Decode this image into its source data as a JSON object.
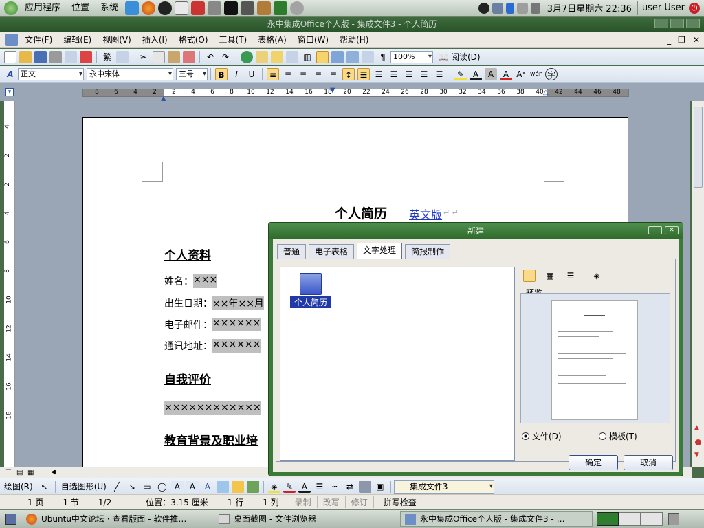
{
  "topbar": {
    "menus": [
      "应用程序",
      "位置",
      "系统"
    ],
    "clock": "3月7日星期六 22:36",
    "user": "user User"
  },
  "window": {
    "title": "永中集成Office个人版 - 集成文件3 - 个人简历"
  },
  "menubar": {
    "items": [
      "文件(F)",
      "编辑(E)",
      "视图(V)",
      "插入(I)",
      "格式(O)",
      "工具(T)",
      "表格(A)",
      "窗口(W)",
      "帮助(H)"
    ]
  },
  "toolbar": {
    "zoom": "100%",
    "read_label": "阅读(D)",
    "style": "正文",
    "font": "永中宋体",
    "size": "三号",
    "bold": "B",
    "italic": "I",
    "underline": "U"
  },
  "ruler": {
    "ticks": [
      "8",
      "6",
      "4",
      "2",
      "2",
      "4",
      "6",
      "8",
      "10",
      "12",
      "14",
      "16",
      "18",
      "20",
      "22",
      "24",
      "26",
      "28",
      "30",
      "32",
      "34",
      "36",
      "38",
      "40",
      "42",
      "44",
      "46",
      "48"
    ]
  },
  "vruler": {
    "ticks": [
      "4",
      "2",
      "2",
      "4",
      "6",
      "8",
      "10",
      "12",
      "14",
      "16",
      "18"
    ]
  },
  "document": {
    "title": "个人简历",
    "english_link": "英文版",
    "sections": [
      {
        "heading": "个人资料"
      },
      {
        "heading": "自我评价"
      },
      {
        "heading": "教育背景及职业培"
      }
    ],
    "fields": [
      {
        "label": "姓名：",
        "value": "×××"
      },
      {
        "label": "出生日期：",
        "value": "××年××月"
      },
      {
        "label": "电子邮件：",
        "value": "××××××"
      },
      {
        "label": "通讯地址：",
        "value": "××××××"
      }
    ],
    "self_eval_placeholder": "××××××××××××"
  },
  "drawbar": {
    "draw_label": "绘图(R)",
    "autoshape_label": "自选图形(U)",
    "file_combo": "集成文件3"
  },
  "status": {
    "page": "1 页",
    "section": "1 节",
    "pages": "1/2",
    "position": "位置：3.15 厘米",
    "line": "1 行",
    "col": "1 列",
    "record": "录制",
    "modify": "改写",
    "revise": "修订",
    "spell": "拼写检查"
  },
  "taskbar": {
    "items": [
      "Ubuntu中文论坛 · 查看版面 - 软件推…",
      "桌面截图 - 文件浏览器",
      "永中集成Office个人版 - 集成文件3 - …"
    ]
  },
  "dialog": {
    "title": "新建",
    "tabs": [
      "普通",
      "电子表格",
      "文字处理",
      "简报制作"
    ],
    "active_tab": "文字处理",
    "template_name": "个人简历",
    "preview_label": "预览",
    "create_as": [
      {
        "label": "文件(D)",
        "checked": true
      },
      {
        "label": "模板(T)",
        "checked": false
      }
    ],
    "ok": "确定",
    "cancel": "取消"
  },
  "colors": {
    "accent": "#3b7a38",
    "selection": "#1f3aa8",
    "placeholder_bg": "#bfbfbf"
  }
}
